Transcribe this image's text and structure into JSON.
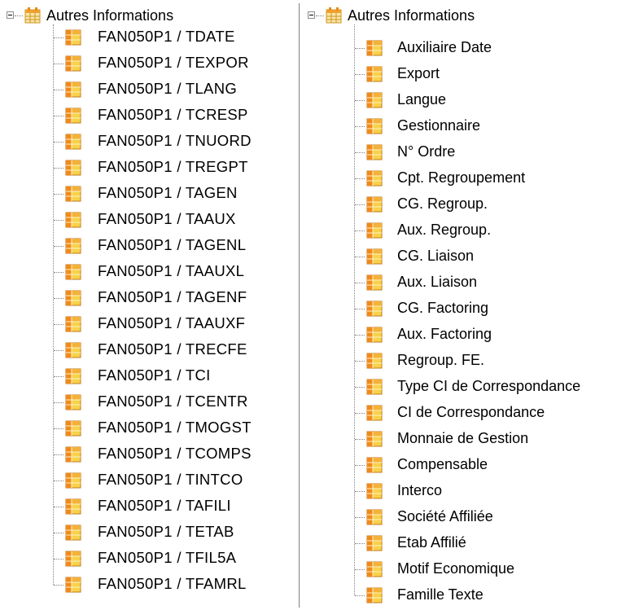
{
  "left_tree": {
    "root": {
      "label": "Autres Informations",
      "icon": "table-icon",
      "expanded": true
    },
    "items": [
      {
        "label": "FAN050P1 / TDATE"
      },
      {
        "label": "FAN050P1 / TEXPOR"
      },
      {
        "label": "FAN050P1 / TLANG"
      },
      {
        "label": "FAN050P1 / TCRESP"
      },
      {
        "label": "FAN050P1 / TNUORD"
      },
      {
        "label": "FAN050P1 / TREGPT"
      },
      {
        "label": "FAN050P1 / TAGEN"
      },
      {
        "label": "FAN050P1 / TAAUX"
      },
      {
        "label": "FAN050P1 / TAGENL"
      },
      {
        "label": "FAN050P1 / TAAUXL"
      },
      {
        "label": "FAN050P1 / TAGENF"
      },
      {
        "label": "FAN050P1 / TAAUXF"
      },
      {
        "label": "FAN050P1 / TRECFE"
      },
      {
        "label": "FAN050P1 / TCI"
      },
      {
        "label": "FAN050P1 / TCENTR"
      },
      {
        "label": "FAN050P1 / TMOGST"
      },
      {
        "label": "FAN050P1 / TCOMPS"
      },
      {
        "label": "FAN050P1 / TINTCO"
      },
      {
        "label": "FAN050P1 / TAFILI"
      },
      {
        "label": "FAN050P1 / TETAB"
      },
      {
        "label": "FAN050P1 / TFIL5A"
      },
      {
        "label": "FAN050P1 / TFAMRL"
      }
    ]
  },
  "right_tree": {
    "root": {
      "label": "Autres Informations",
      "icon": "table-icon",
      "expanded": true
    },
    "items": [
      {
        "label": "Auxiliaire Date"
      },
      {
        "label": "Export"
      },
      {
        "label": "Langue"
      },
      {
        "label": "Gestionnaire"
      },
      {
        "label": "N° Ordre"
      },
      {
        "label": "Cpt. Regroupement"
      },
      {
        "label": "CG. Regroup."
      },
      {
        "label": "Aux. Regroup."
      },
      {
        "label": "CG. Liaison"
      },
      {
        "label": "Aux. Liaison"
      },
      {
        "label": "CG. Factoring"
      },
      {
        "label": "Aux. Factoring"
      },
      {
        "label": "Regroup. FE."
      },
      {
        "label": "Type CI de Correspondance"
      },
      {
        "label": "CI de Correspondance"
      },
      {
        "label": "Monnaie de Gestion"
      },
      {
        "label": "Compensable"
      },
      {
        "label": "Interco"
      },
      {
        "label": "Société Affiliée"
      },
      {
        "label": "Etab Affilié"
      },
      {
        "label": "Motif Economique"
      },
      {
        "label": "Famille Texte"
      }
    ]
  },
  "item_icon": "field-icon",
  "colors": {
    "icon_orange": "#f08a1c",
    "icon_yellow": "#f7d24a",
    "icon_border": "#c07a20",
    "tree_lines": "#808080"
  }
}
